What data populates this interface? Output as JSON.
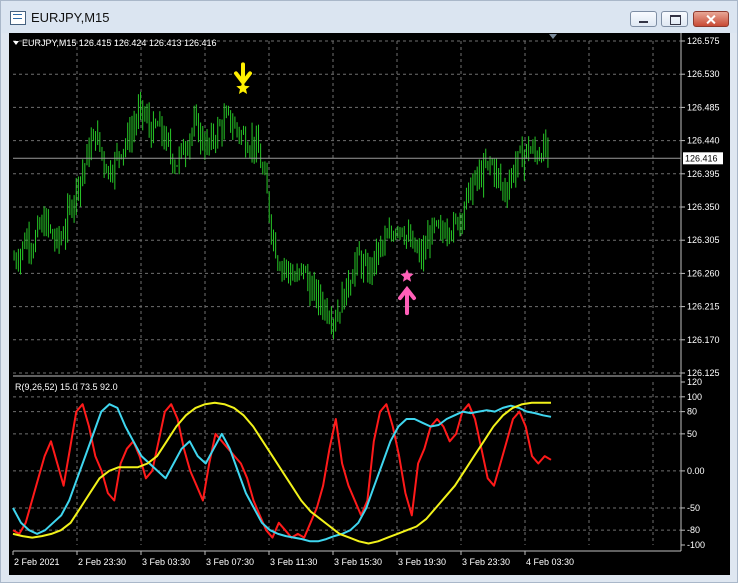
{
  "window": {
    "title": "EURJPY,M15"
  },
  "price_panel": {
    "header": "EURJPY,M15  126.415 126.424 126.413 126.416",
    "current_price_label": "126.416",
    "y_ticks": [
      "126.575",
      "126.530",
      "126.485",
      "126.440",
      "126.395",
      "126.350",
      "126.305",
      "126.260",
      "126.215",
      "126.170",
      "126.125"
    ],
    "sell_marker_icon": "yellow-down-arrow-star",
    "buy_marker_icon": "pink-up-arrow-star"
  },
  "indicator_panel": {
    "header": "R(9,26,52) 15.0 73.5 92.0",
    "y_ticks": [
      "120",
      "100",
      "80",
      "50",
      "0.00",
      "-50",
      "-80",
      "-100"
    ]
  },
  "x_axis": {
    "labels": [
      "2 Feb 2021",
      "2 Feb 23:30",
      "3 Feb 03:30",
      "3 Feb 07:30",
      "3 Feb 11:30",
      "3 Feb 15:30",
      "3 Feb 19:30",
      "3 Feb 23:30",
      "4 Feb 03:30"
    ]
  },
  "colors": {
    "background": "#000000",
    "grid": "#6f6f6f",
    "candles": "#27c827",
    "line_fast": "#ff1a1a",
    "line_mid": "#3fd6ef",
    "line_slow": "#f2f21a",
    "sell_marker": "#ffef00",
    "buy_marker": "#ff5fb8"
  },
  "chart_data": [
    {
      "type": "candlestick",
      "title": "EURJPY,M15",
      "ylim": [
        126.125,
        126.575
      ],
      "current_price": 126.416,
      "close_path": [
        126.28,
        126.29,
        126.31,
        126.3,
        126.32,
        126.33,
        126.31,
        126.3,
        126.32,
        126.35,
        126.38,
        126.4,
        126.43,
        126.45,
        126.42,
        126.4,
        126.41,
        126.43,
        126.44,
        126.46,
        126.48,
        126.47,
        126.45,
        126.46,
        126.44,
        126.42,
        126.41,
        126.43,
        126.45,
        126.46,
        126.44,
        126.43,
        126.45,
        126.46,
        126.47,
        126.46,
        126.45,
        126.44,
        126.44,
        126.42,
        126.38,
        126.32,
        126.28,
        126.27,
        126.26,
        126.25,
        126.27,
        126.24,
        126.23,
        126.22,
        126.21,
        126.2,
        126.22,
        126.24,
        126.27,
        126.28,
        126.26,
        126.27,
        126.29,
        126.3,
        126.31,
        126.33,
        126.32,
        126.3,
        126.29,
        126.28,
        126.31,
        126.32,
        126.31,
        126.33,
        126.32,
        126.34,
        126.36,
        126.38,
        126.39,
        126.4,
        126.41,
        126.39,
        126.37,
        126.39,
        126.41,
        126.42,
        126.43,
        126.42,
        126.43,
        126.42
      ],
      "signals": [
        {
          "type": "sell",
          "price": 126.5
        },
        {
          "type": "buy",
          "price": 126.255
        }
      ]
    },
    {
      "type": "line",
      "title": "R(9,26,52)",
      "ylim": [
        -100,
        120
      ],
      "series": [
        {
          "name": "R(9)",
          "values": [
            -80,
            -85,
            -70,
            -40,
            -10,
            20,
            40,
            10,
            -20,
            30,
            80,
            90,
            60,
            20,
            0,
            -30,
            -40,
            10,
            30,
            40,
            20,
            -10,
            0,
            40,
            80,
            90,
            70,
            30,
            0,
            -20,
            -40,
            10,
            50,
            40,
            30,
            20,
            10,
            -10,
            -40,
            -60,
            -80,
            -90,
            -70,
            -80,
            -90,
            -85,
            -90,
            -70,
            -50,
            -20,
            30,
            70,
            10,
            -20,
            -40,
            -60,
            -40,
            40,
            80,
            90,
            60,
            20,
            -30,
            -60,
            10,
            30,
            60,
            70,
            60,
            40,
            50,
            80,
            90,
            70,
            30,
            -10,
            -20,
            10,
            40,
            70,
            80,
            60,
            20,
            10,
            20,
            15
          ]
        },
        {
          "name": "R(26)",
          "values": [
            -50,
            -70,
            -80,
            -85,
            -80,
            -70,
            -60,
            -40,
            -10,
            20,
            50,
            80,
            90,
            85,
            60,
            40,
            20,
            10,
            0,
            -10,
            10,
            30,
            40,
            20,
            10,
            30,
            50,
            30,
            0,
            -30,
            -50,
            -70,
            -80,
            -85,
            -88,
            -90,
            -92,
            -95,
            -95,
            -92,
            -88,
            -85,
            -80,
            -70,
            -50,
            -20,
            10,
            40,
            60,
            70,
            70,
            65,
            60,
            62,
            70,
            75,
            80,
            78,
            80,
            82,
            80,
            85,
            88,
            85,
            80,
            78,
            75,
            73
          ]
        },
        {
          "name": "R(52)",
          "values": [
            -85,
            -88,
            -90,
            -88,
            -85,
            -80,
            -70,
            -50,
            -30,
            -10,
            0,
            5,
            5,
            5,
            10,
            20,
            40,
            60,
            75,
            85,
            90,
            92,
            90,
            85,
            75,
            60,
            40,
            20,
            0,
            -20,
            -40,
            -55,
            -65,
            -75,
            -85,
            -90,
            -95,
            -98,
            -95,
            -90,
            -85,
            -80,
            -75,
            -65,
            -50,
            -35,
            -20,
            0,
            20,
            40,
            60,
            75,
            85,
            90,
            92,
            92,
            92
          ]
        }
      ]
    }
  ]
}
